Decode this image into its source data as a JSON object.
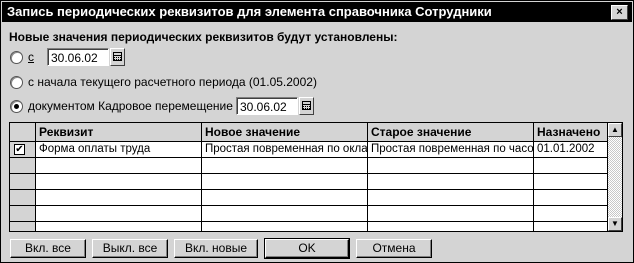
{
  "window": {
    "title": "Запись периодических реквизитов для элемента справочника Сотрудники",
    "close_glyph": "×"
  },
  "heading": "Новые значения периодических реквизитов будут установлены:",
  "options": [
    {
      "label": "с",
      "selected": false,
      "date": "30.06.02"
    },
    {
      "label": "с начала текущего расчетного периода (01.05.2002)",
      "selected": false
    },
    {
      "label": "документом Кадровое перемещение с",
      "selected": true,
      "date": "30.06.02"
    }
  ],
  "table": {
    "columns": [
      "Реквизит",
      "Новое значение",
      "Старое значение",
      "Назначено"
    ],
    "rows": [
      {
        "checked": true,
        "check_glyph": "✔",
        "cells": [
          "Форма оплаты труда",
          "Простая повременная по оклад",
          "Простая повременная по часов",
          "01.01.2002"
        ]
      },
      {
        "checked": false,
        "check_glyph": "",
        "cells": [
          "",
          "",
          "",
          ""
        ]
      },
      {
        "checked": false,
        "check_glyph": "",
        "cells": [
          "",
          "",
          "",
          ""
        ]
      },
      {
        "checked": false,
        "check_glyph": "",
        "cells": [
          "",
          "",
          "",
          ""
        ]
      },
      {
        "checked": false,
        "check_glyph": "",
        "cells": [
          "",
          "",
          "",
          ""
        ]
      },
      {
        "checked": false,
        "check_glyph": "",
        "cells": [
          "",
          "",
          "",
          ""
        ]
      }
    ],
    "scroll_up_glyph": "▲",
    "scroll_down_glyph": "▼"
  },
  "buttons": {
    "select_all": "Вкл. все",
    "deselect_all": "Выкл. все",
    "select_new": "Вкл. новые",
    "ok": "OK",
    "cancel": "Отмена"
  },
  "icons": {
    "calendar": "calendar-icon",
    "check": "checkmark-icon"
  }
}
